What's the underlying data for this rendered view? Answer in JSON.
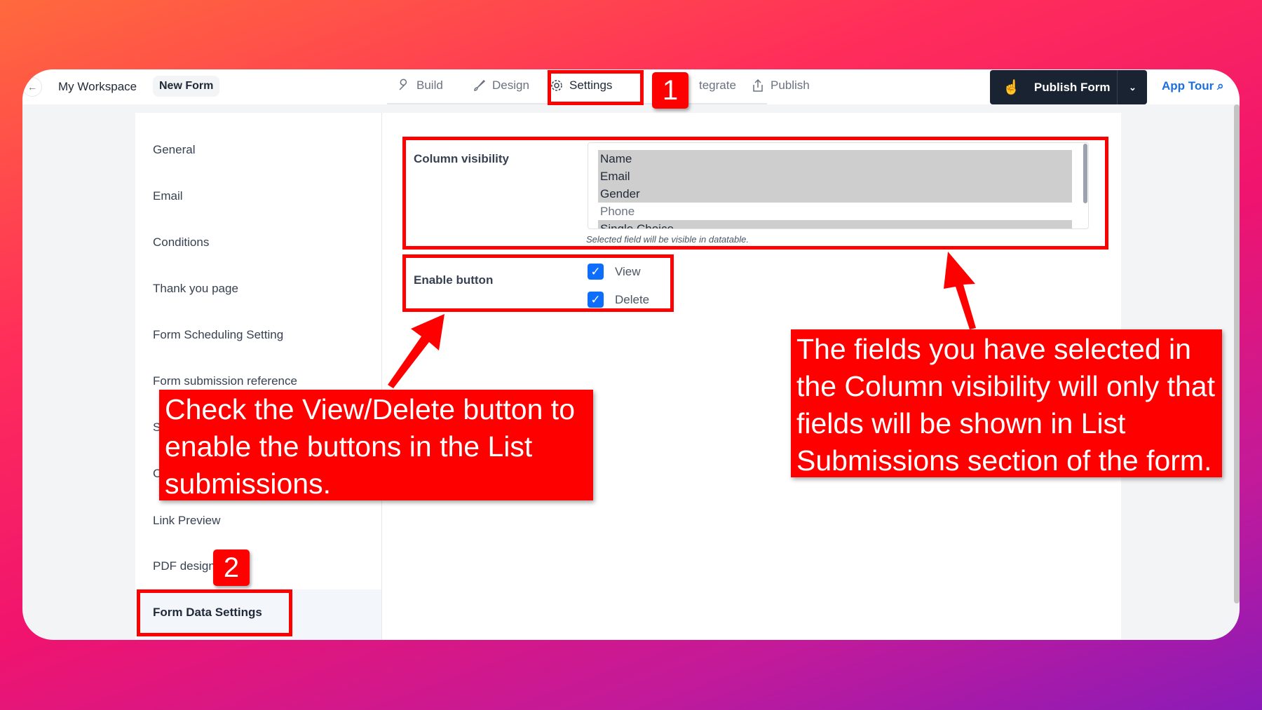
{
  "topbar": {
    "workspace": "My Workspace",
    "form_name": "New Form",
    "tabs": [
      {
        "label": "Build",
        "icon": "wrench-icon"
      },
      {
        "label": "Design",
        "icon": "brush-icon"
      },
      {
        "label": "Settings",
        "icon": "gear-icon"
      },
      {
        "label": "tegrate"
      },
      {
        "label": "Publish",
        "icon": "share-icon"
      }
    ],
    "publish_button": "Publish Form",
    "app_tour": "App Tour"
  },
  "sidebar": {
    "items": [
      "General",
      "Email",
      "Conditions",
      "Thank you page",
      "Form Scheduling Setting",
      "Form submission reference",
      "S",
      "C",
      "Link Preview",
      "PDF design",
      "Form Data Settings"
    ],
    "active": "Form Data Settings"
  },
  "main": {
    "column_visibility": {
      "label": "Column visibility",
      "options": [
        {
          "label": "Name",
          "selected": true
        },
        {
          "label": "Email",
          "selected": true
        },
        {
          "label": "Gender",
          "selected": true
        },
        {
          "label": "Phone",
          "selected": false
        },
        {
          "label": "Single Choice",
          "selected": true
        }
      ],
      "hint": "Selected field will be visible in datatable."
    },
    "enable_button": {
      "label": "Enable button",
      "options": [
        {
          "label": "View",
          "checked": true
        },
        {
          "label": "Delete",
          "checked": true
        }
      ]
    }
  },
  "annotations": {
    "badge1": "1",
    "badge2": "2",
    "callout_left": "Check the View/Delete button to enable the buttons in the List submissions.",
    "callout_right": "The fields you have selected in the Column visibility will only that fields will be shown in List Submissions section of the form."
  },
  "colors": {
    "annotation": "#ff0000",
    "publish_bg": "#1a2332",
    "accent": "#0d6efd"
  }
}
